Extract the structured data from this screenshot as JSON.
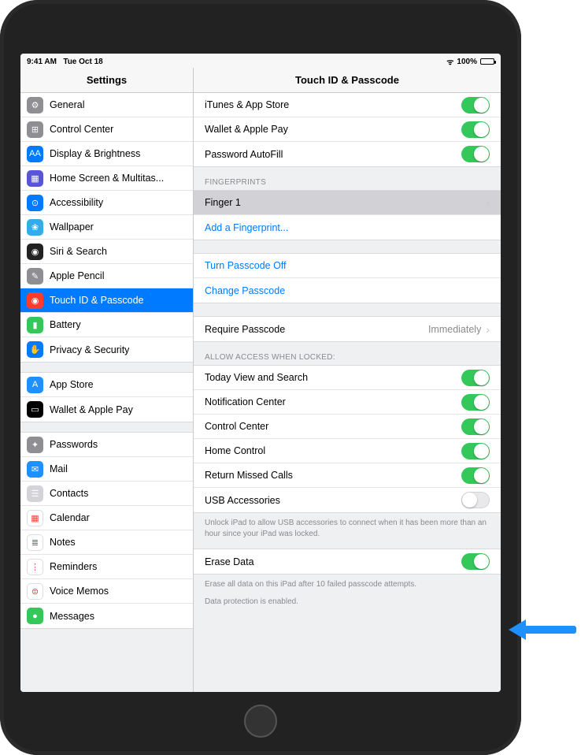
{
  "status": {
    "time": "9:41 AM",
    "date": "Tue Oct 18",
    "battery_pct": "100%"
  },
  "nav": {
    "left_title": "Settings",
    "right_title": "Touch ID & Passcode"
  },
  "sidebar": {
    "groups": [
      {
        "items": [
          {
            "label": "General",
            "icon": "⚙︎",
            "bg": "#8e8e93"
          },
          {
            "label": "Control Center",
            "icon": "⊞",
            "bg": "#8e8e93"
          },
          {
            "label": "Display & Brightness",
            "icon": "AA",
            "bg": "#007aff"
          },
          {
            "label": "Home Screen & Multitas...",
            "icon": "▦",
            "bg": "#5856d6"
          },
          {
            "label": "Accessibility",
            "icon": "⊙",
            "bg": "#007aff"
          },
          {
            "label": "Wallpaper",
            "icon": "❀",
            "bg": "#32ade6"
          },
          {
            "label": "Siri & Search",
            "icon": "◉",
            "bg": "#222"
          },
          {
            "label": "Apple Pencil",
            "icon": "✎",
            "bg": "#8e8e93"
          },
          {
            "label": "Touch ID & Passcode",
            "icon": "◉",
            "bg": "#ff3b30",
            "selected": true
          },
          {
            "label": "Battery",
            "icon": "▮",
            "bg": "#34c759"
          },
          {
            "label": "Privacy & Security",
            "icon": "✋",
            "bg": "#007aff"
          }
        ]
      },
      {
        "items": [
          {
            "label": "App Store",
            "icon": "A",
            "bg": "#1e90ff"
          },
          {
            "label": "Wallet & Apple Pay",
            "icon": "▭",
            "bg": "#000"
          }
        ]
      },
      {
        "items": [
          {
            "label": "Passwords",
            "icon": "✦",
            "bg": "#8e8e93"
          },
          {
            "label": "Mail",
            "icon": "✉",
            "bg": "#1e90ff"
          },
          {
            "label": "Contacts",
            "icon": "☰",
            "bg": "#d4d4d8"
          },
          {
            "label": "Calendar",
            "icon": "▦",
            "bg": "#fff"
          },
          {
            "label": "Notes",
            "icon": "≣",
            "bg": "#fff"
          },
          {
            "label": "Reminders",
            "icon": "⋮",
            "bg": "#fff"
          },
          {
            "label": "Voice Memos",
            "icon": "⊜",
            "bg": "#fff"
          },
          {
            "label": "Messages",
            "icon": "●",
            "bg": "#34c759"
          }
        ]
      }
    ]
  },
  "content": {
    "use_touchid": {
      "items": [
        {
          "label": "iTunes & App Store",
          "on": true
        },
        {
          "label": "Wallet & Apple Pay",
          "on": true
        },
        {
          "label": "Password AutoFill",
          "on": true
        }
      ]
    },
    "fingerprints": {
      "header": "Fingerprints",
      "items": [
        {
          "label": "Finger 1",
          "highlighted": true,
          "disclosure": true
        },
        {
          "label": "Add a Fingerprint...",
          "link": true
        }
      ]
    },
    "passcode_actions": {
      "items": [
        {
          "label": "Turn Passcode Off",
          "link": true
        },
        {
          "label": "Change Passcode",
          "link": true
        }
      ]
    },
    "require": {
      "label": "Require Passcode",
      "value": "Immediately"
    },
    "allow_locked": {
      "header": "Allow Access When Locked:",
      "items": [
        {
          "label": "Today View and Search",
          "on": true
        },
        {
          "label": "Notification Center",
          "on": true
        },
        {
          "label": "Control Center",
          "on": true
        },
        {
          "label": "Home Control",
          "on": true
        },
        {
          "label": "Return Missed Calls",
          "on": true
        },
        {
          "label": "USB Accessories",
          "on": false
        }
      ],
      "footer": "Unlock iPad to allow USB accessories to connect when it has been more than an hour since your iPad was locked."
    },
    "erase": {
      "label": "Erase Data",
      "on": true,
      "footer1": "Erase all data on this iPad after 10 failed passcode attempts.",
      "footer2": "Data protection is enabled."
    }
  }
}
